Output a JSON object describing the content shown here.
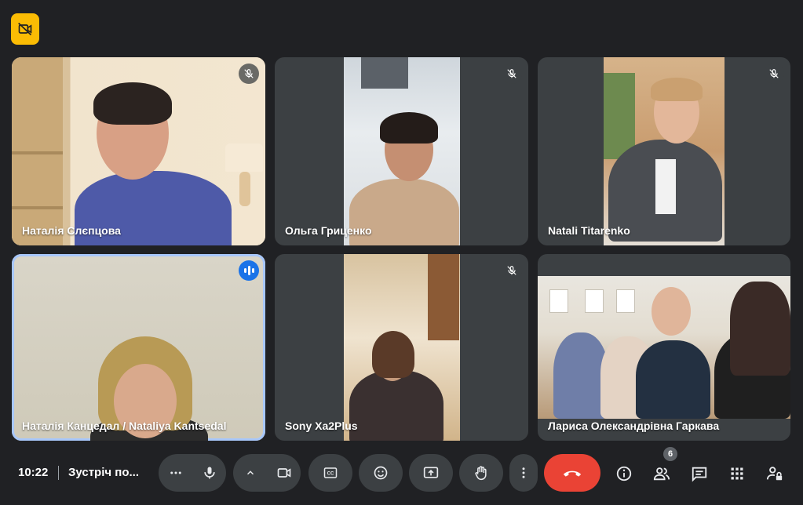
{
  "participants": [
    {
      "name": "Наталія Слєпцова",
      "muted": true
    },
    {
      "name": "Ольга Гриценко",
      "muted": true
    },
    {
      "name": "Natali Titarenko",
      "muted": true
    },
    {
      "name": "Наталія Канцедал / Nataliya Kantsedal",
      "muted": false,
      "speaking": true
    },
    {
      "name": "Sony Xa2Plus",
      "muted": true
    },
    {
      "name": "Лариса Олександрівна Гаркава",
      "muted": false
    }
  ],
  "bottom_bar": {
    "time": "10:22",
    "meeting_title": "Зустріч по...",
    "people_count": "6"
  },
  "colors": {
    "background": "#202124",
    "tile": "#3c4043",
    "accent_speaking": "#a8c7fa",
    "hangup": "#ea4335",
    "warning_badge": "#fbbc04"
  },
  "icons": {
    "top_left": "camera-off-icon",
    "more": "more-horizontal-icon",
    "mic": "mic-icon",
    "chevron": "chevron-up-icon",
    "camera": "videocam-icon",
    "captions": "closed-captions-icon",
    "emoji": "emoji-icon",
    "present": "present-screen-icon",
    "hand": "raise-hand-icon",
    "more_vertical": "more-vertical-icon",
    "hangup": "call-end-icon",
    "info": "info-icon",
    "people": "people-icon",
    "chat": "chat-icon",
    "activities": "apps-grid-icon",
    "host_controls": "lock-person-icon"
  }
}
